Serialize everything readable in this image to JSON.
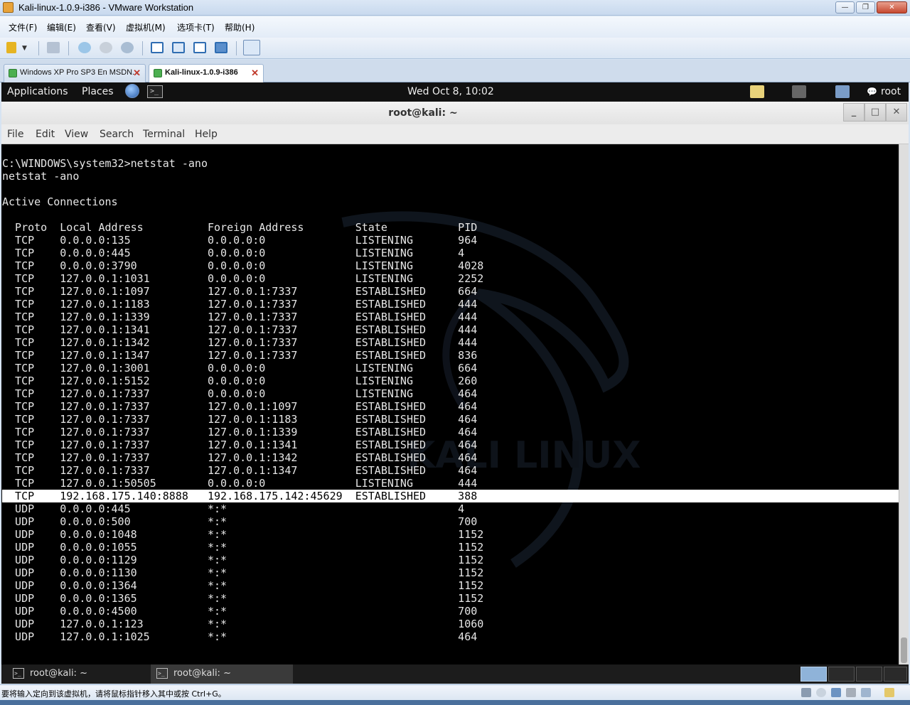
{
  "vmware": {
    "title": "Kali-linux-1.0.9-i386 - VMware Workstation",
    "menu": [
      "文件(F)",
      "编辑(E)",
      "查看(V)",
      "虚拟机(M)",
      "选项卡(T)",
      "帮助(H)"
    ],
    "tabs": [
      {
        "label": "Windows XP Pro SP3 En MSDN..."
      },
      {
        "label": "Kali-linux-1.0.9-i386"
      }
    ],
    "status_message": "要将输入定向到该虚拟机，请将鼠标指针移入其中或按 Ctrl+G。",
    "colors": {
      "chrome": "#d6e3f2",
      "close_button": "#c6482f"
    }
  },
  "gnome_panel": {
    "applications": "Applications",
    "places": "Places",
    "clock": "Wed Oct  8, 10:02",
    "user": "root"
  },
  "terminal": {
    "title": "root@kali: ~",
    "menu": [
      "File",
      "Edit",
      "View",
      "Search",
      "Terminal",
      "Help"
    ],
    "lines": [
      "",
      "C:\\WINDOWS\\system32>netstat -ano",
      "netstat -ano",
      "",
      "Active Connections",
      "",
      "  Proto  Local Address          Foreign Address        State           PID",
      "  TCP    0.0.0.0:135            0.0.0.0:0              LISTENING       964",
      "  TCP    0.0.0.0:445            0.0.0.0:0              LISTENING       4",
      "  TCP    0.0.0.0:3790           0.0.0.0:0              LISTENING       4028",
      "  TCP    127.0.0.1:1031         0.0.0.0:0              LISTENING       2252",
      "  TCP    127.0.0.1:1097         127.0.0.1:7337         ESTABLISHED     664",
      "  TCP    127.0.0.1:1183         127.0.0.1:7337         ESTABLISHED     444",
      "  TCP    127.0.0.1:1339         127.0.0.1:7337         ESTABLISHED     444",
      "  TCP    127.0.0.1:1341         127.0.0.1:7337         ESTABLISHED     444",
      "  TCP    127.0.0.1:1342         127.0.0.1:7337         ESTABLISHED     444",
      "  TCP    127.0.0.1:1347         127.0.0.1:7337         ESTABLISHED     836",
      "  TCP    127.0.0.1:3001         0.0.0.0:0              LISTENING       664",
      "  TCP    127.0.0.1:5152         0.0.0.0:0              LISTENING       260",
      "  TCP    127.0.0.1:7337         0.0.0.0:0              LISTENING       464",
      "  TCP    127.0.0.1:7337         127.0.0.1:1097         ESTABLISHED     464",
      "  TCP    127.0.0.1:7337         127.0.0.1:1183         ESTABLISHED     464",
      "  TCP    127.0.0.1:7337         127.0.0.1:1339         ESTABLISHED     464",
      "  TCP    127.0.0.1:7337         127.0.0.1:1341         ESTABLISHED     464",
      "  TCP    127.0.0.1:7337         127.0.0.1:1342         ESTABLISHED     464",
      "  TCP    127.0.0.1:7337         127.0.0.1:1347         ESTABLISHED     464",
      "  TCP    127.0.0.1:50505        0.0.0.0:0              LISTENING       444",
      "  TCP    192.168.175.140:8888   192.168.175.142:45629  ESTABLISHED     388",
      "  UDP    0.0.0.0:445            *:*                                    4",
      "  UDP    0.0.0.0:500            *:*                                    700",
      "  UDP    0.0.0.0:1048           *:*                                    1152",
      "  UDP    0.0.0.0:1055           *:*                                    1152",
      "  UDP    0.0.0.0:1129           *:*                                    1152",
      "  UDP    0.0.0.0:1130           *:*                                    1152",
      "  UDP    0.0.0.0:1364           *:*                                    1152",
      "  UDP    0.0.0.0:1365           *:*                                    1152",
      "  UDP    0.0.0.0:4500           *:*                                    700",
      "  UDP    127.0.0.1:123          *:*                                    1060",
      "  UDP    127.0.0.1:1025         *:*                                    464"
    ],
    "selected_line_index": 27
  },
  "taskbar": {
    "items": [
      {
        "label": "root@kali: ~"
      },
      {
        "label": "root@kali: ~"
      }
    ]
  }
}
